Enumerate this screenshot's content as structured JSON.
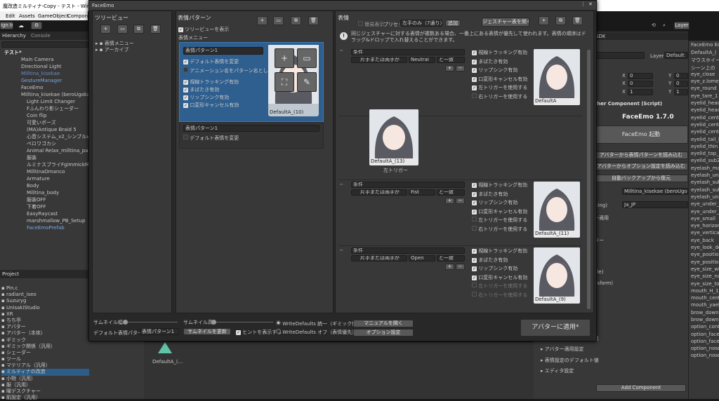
{
  "window": {
    "title": "魔改造ミルティナ-Copy - テスト - Windows, M",
    "menu": [
      "Edit",
      "Assets",
      "GameObject",
      "Compone"
    ],
    "signin": "ign In"
  },
  "hierarchy": {
    "tab": "Hierarchy",
    "console": "Console",
    "items": [
      "テスト*",
      "Main Camera",
      "Directional Light",
      "Milltina_kisekae",
      "GestureManager",
      "FaceEmo",
      "Milltina_kisekae (beroUgokashi",
      "Light Limit Changer",
      "Fふんわり影シェーダー",
      "Coin flip",
      "可愛いポーズ",
      "(MA)Antique Braid 5",
      "心音システム_v2_シンプルver",
      "ペロワゴカシ",
      "Animal Relax_milltina_panda",
      "服装",
      "ルミナスプライFgimmickMA",
      "MilltinaOmanco",
      "Armature",
      "Body",
      "Milltina_body",
      "服装OFF",
      "下着OFF",
      "EasyRaycast",
      "marshmallow_PB_Setup",
      "FaceEmoPrefab"
    ]
  },
  "project": {
    "tab": "Project",
    "folders": [
      "Pin.c",
      "radiant_iseo",
      "Suzuryg",
      "UnisakiStudio",
      "XR",
      "ちち亭",
      "アバター",
      "アバター（本体）",
      "ギミック",
      "ギミック関係（汎用）",
      "シェーダー",
      "ツール",
      "マテリアル（汎用）",
      "ミルティナの改造",
      "小物（汎用）",
      "服（汎用）",
      "曜デスクチャー",
      "肌設定（汎用）"
    ],
    "asset": "DefaultA_(..."
  },
  "faceemo": {
    "window_title": "FaceEmo",
    "tree": {
      "title": "ツリービュー",
      "items": [
        "表情メニュー",
        "アーカイブ"
      ]
    },
    "patterns": {
      "title": "表情パターン",
      "show_tree": "ツリービューを表示",
      "menu_label": "表情メニュー",
      "group1": "表情パターン1",
      "opts1": [
        "デフォルト表情を変更",
        "アニメーション名をパターン名として使用",
        "視線トラッキング有効",
        "まばたき有効",
        "リップシンク有効",
        "口変形キャンセル有効"
      ],
      "thumb1": "DefaultA_(10)",
      "group2": "表情パターン1",
      "opts2": [
        "デフォルト表情を変更"
      ]
    },
    "expr": {
      "title": "表情",
      "simple": "簡易表示",
      "preset_label": "プリセット",
      "preset_value": "左手のみ（7通り）",
      "add": "追加",
      "gesture_table": "ジェスチャー表を開く",
      "info": "同じジェスチャーに対する表情が複数ある場合、一番上にある表情が優先して使われます。表情の順序はドラッグ&ドロップで入れ替えることができます。",
      "default_thumb": "DefaultA_(13)",
      "default_caption": "左トリガー",
      "rows": [
        {
          "cond": "条件",
          "hand": "片手または両手が",
          "gesture": "Neutral",
          "eq": "と一致",
          "thumb": "DefaultA"
        },
        {
          "cond": "条件",
          "hand": "片手または両手が",
          "gesture": "Fist",
          "eq": "と一致",
          "thumb": "DefaultA_(11)"
        },
        {
          "cond": "条件",
          "hand": "片手または両手が",
          "gesture": "Open",
          "eq": "と一致",
          "thumb": "DefaultA_(9)"
        }
      ],
      "row_opts": [
        "視線トラッキング有効",
        "まばたき有効",
        "リップシンク有効",
        "口変形キャンセル有効",
        "左トリガーを使用する",
        "右トリガーを使用する"
      ]
    },
    "bottom": {
      "thumb_w": "サムネイル幅",
      "thumb_h": "サムネイル高",
      "default_label": "デフォルト表情パターン",
      "default_value": "表情パターン1",
      "update_thumb": "サムネイルを更新",
      "show_hint": "ヒントを表示する",
      "wd_on": "WriteDefaults 統一（ギミック優先）",
      "wd_off": "WriteDefaults オフ（表情優先）",
      "manual": "マニュアルを開く",
      "options": "オプション設定",
      "apply": "アバターに適用*"
    }
  },
  "inspector": {
    "sdk": "SDK",
    "layers": "Layers",
    "layout": "Layo",
    "layer_label": "Layer",
    "layer_value": "Default",
    "xyz": [
      [
        "X",
        "0",
        "Y",
        "0"
      ],
      [
        "X",
        "0",
        "Y",
        "0"
      ],
      [
        "X",
        "1",
        "Y",
        "1"
      ]
    ],
    "component": "cher Component (Script)",
    "version": "FaceEmo 1.7.0",
    "launch": "FaceEmo 起動",
    "import1": "アバターから表情パターンを読み込む",
    "import2": "アバターからオプション設定を読み込む",
    "restore": "自動バックアップから復元",
    "avatar": "Milltina_kisekae (beroUgok",
    "lang_label": "tting)",
    "lang": "Ja_JP",
    "misc": [
      "ー適用",
      "ター",
      "gle)",
      "nsform)",
      "目"
    ],
    "foldouts": [
      "アバター適用設定",
      "表情設定のデフォルト値",
      "エディタ設定"
    ],
    "add_component": "Add Component"
  },
  "facepanel": {
    "title": "FaceEmo Edi",
    "items": [
      "DefaultA_(",
      "マウスホイー",
      "シーン上の",
      "eye_close",
      "eye_z.lome_",
      "eye_round",
      "eye_tare_1",
      "eyelid_head_",
      "eyelid_head_",
      "eyelid_cente",
      "eyelid_cente",
      "eyelid_cente",
      "eyelid_tail_lo",
      "eyelid_thin",
      "eyelid_top_li",
      "eyelid_sub2_",
      "eyelash_mai",
      "eyelash_unde",
      "eyelash_subl",
      "eyelash_subl",
      "eyelash_unde",
      "eye_under_c",
      "eye_under_c",
      "eye_small",
      "eye_horizont",
      "eye_vertical",
      "eye_back",
      "eye_look_do",
      "eye_position_",
      "eye_position_",
      "eye_size_wid",
      "eye_size_nar",
      "eye_size_top",
      "mouth_H_1_H",
      "mouth_cente",
      "mouth_yaeb",
      "brow_down",
      "brow_down_t",
      "option_conto",
      "option_face_",
      "option_face_",
      "option_nose_",
      "option_nose_"
    ]
  }
}
